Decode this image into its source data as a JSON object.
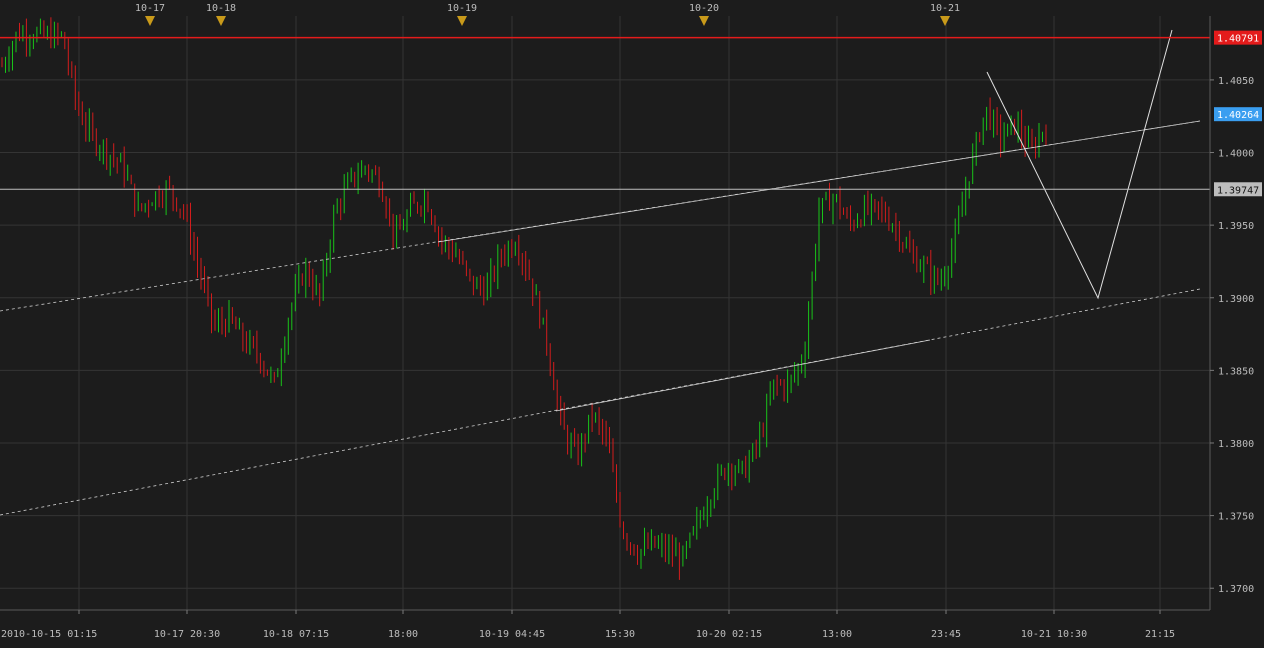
{
  "chart_data": {
    "type": "candlestick",
    "instrument_hint": "",
    "x_tick_labels": [
      "2010-10-15 01:15",
      "10-17 20:30",
      "10-18 07:15",
      "18:00",
      "10-19 04:45",
      "15:30",
      "10-20 02:15",
      "13:00",
      "23:45",
      "10-21 10:30",
      "21:15"
    ],
    "date_markers": [
      "10-17",
      "10-18",
      "10-19",
      "10-20",
      "10-21"
    ],
    "y_ticks": [
      1.37,
      1.375,
      1.38,
      1.385,
      1.39,
      1.395,
      1.4,
      1.405
    ],
    "y_tick_labels": [
      "1.3700",
      "1.3750",
      "1.3800",
      "1.3850",
      "1.3900",
      "1.3950",
      "1.4000",
      "1.4050"
    ],
    "ylim": [
      1.3685,
      1.4094
    ],
    "price_tags": [
      {
        "label": "1.40791",
        "value": 1.40791,
        "color": "#e41b1b",
        "text_color": "#ffffff",
        "line": "solid-red"
      },
      {
        "label": "1.40264",
        "value": 1.40264,
        "color": "#3a9ef0",
        "text_color": "#ffffff",
        "line": "none"
      },
      {
        "label": "1.39747",
        "value": 1.39747,
        "color": "#bdbdbd",
        "text_color": "#111111",
        "line": "solid-gray"
      }
    ],
    "approx_close_path": [
      1.406,
      1.4082,
      1.4082,
      1.408,
      1.408,
      1.403,
      1.401,
      1.4,
      1.399,
      1.396,
      1.397,
      1.3975,
      1.396,
      1.392,
      1.388,
      1.3885,
      1.387,
      1.386,
      1.384,
      1.389,
      1.392,
      1.39,
      1.396,
      1.398,
      1.399,
      1.398,
      1.394,
      1.396,
      1.397,
      1.394,
      1.393,
      1.391,
      1.3905,
      1.393,
      1.394,
      1.391,
      1.387,
      1.381,
      1.379,
      1.382,
      1.38,
      1.374,
      1.3725,
      1.373,
      1.3725,
      1.372,
      1.3745,
      1.377,
      1.3785,
      1.378,
      1.38,
      1.384,
      1.384,
      1.386,
      1.396,
      1.397,
      1.395,
      1.396,
      1.396,
      1.395,
      1.393,
      1.392,
      1.391,
      1.394,
      1.399,
      1.403,
      1.401,
      1.402,
      1.4,
      1.402
    ],
    "colors": {
      "up": "#19c319",
      "down": "#d21c1c",
      "background": "#1c1c1c",
      "grid": "#343434",
      "axis_text": "#bdbdbd",
      "marker": "#c99a1a"
    },
    "grid": true,
    "annotations": [
      "upper dashed trendline",
      "middle solid/dashed trendline",
      "lower dashed trendline",
      "projection zigzag"
    ]
  }
}
